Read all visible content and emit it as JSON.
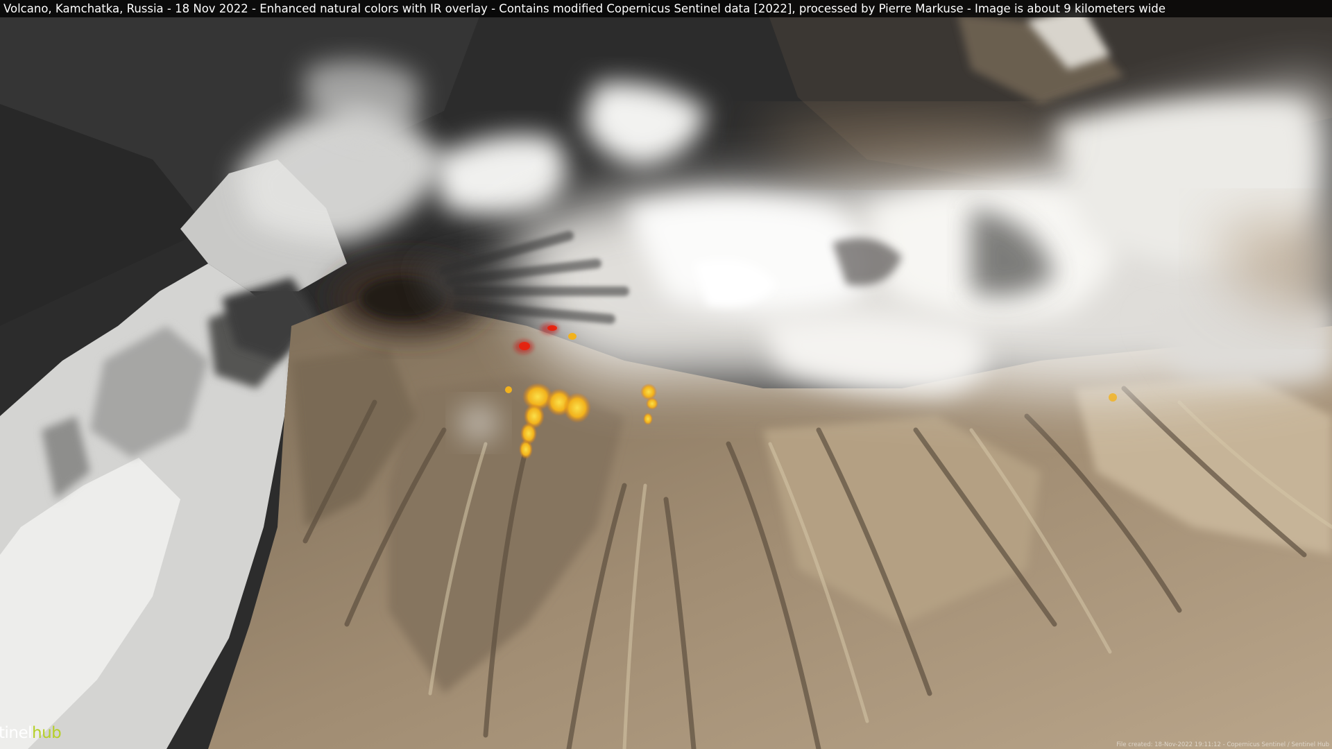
{
  "caption": "Volcano, Kamchatka, Russia - 18 Nov 2022 - Enhanced natural colors with IR overlay - Contains modified Copernicus Sentinel data [2022], processed by Pierre Markuse - Image is about 9 kilometers wide",
  "logo": {
    "part1": "tinel",
    "part2": "hub"
  },
  "footer_note": "File created: 18-Nov-2022 19:11:12 - Copernicus Sentinel / Sentinel Hub",
  "colors": {
    "logo_accent": "#b5cf2a",
    "hotspot_yellow": "#f4c020",
    "hotspot_red": "#e82010",
    "plume": "#f2f0ec",
    "terrain": "#9c8a72",
    "snow": "#e6e6e6"
  }
}
